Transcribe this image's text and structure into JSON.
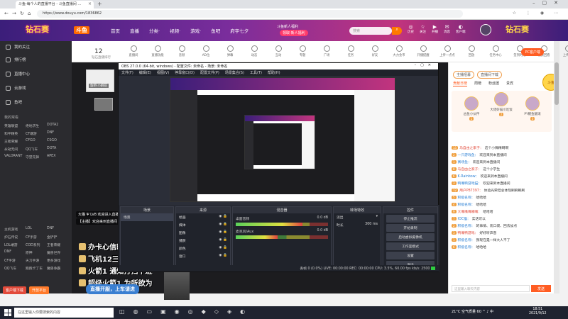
{
  "browser": {
    "tab_title": "斗鱼-每个人的直播平台 - 斗鱼直播间 ...",
    "url": "https://www.douyu.com/1836862",
    "nav": [
      "←",
      "→",
      "↻",
      "⌂"
    ]
  },
  "header": {
    "brand": "钻石赛",
    "logo": "斗鱼",
    "nav": [
      "首页",
      "直播",
      "分类·",
      "视频·",
      "游戏·",
      "鱼吧",
      "府宇七夕"
    ],
    "promo_line": "斗鱼新人福利",
    "promo_btn": "领取·新人福利",
    "search_placeholder": "搜索",
    "user_icons": [
      {
        "icon": "◎",
        "label": "历史"
      },
      {
        "icon": "☆",
        "label": "关注"
      },
      {
        "icon": "▶",
        "label": "开播"
      },
      {
        "icon": "✉",
        "label": "消息"
      },
      {
        "icon": "◐",
        "label": "客户端"
      }
    ],
    "brand2": "钻石赛"
  },
  "sidebar": {
    "items": [
      {
        "label": "我的关注"
      },
      {
        "label": "排行榜"
      },
      {
        "label": "直播中心"
      },
      {
        "label": "云游戏"
      },
      {
        "label": "鱼吧"
      }
    ],
    "category_title": "我的常看",
    "grid": [
      "英雄联盟",
      "绝地求生",
      "DOTA2",
      "和平精英",
      "CF端游",
      "DNF",
      "王者荣耀",
      "CFGO",
      "CSGO",
      "永劫无间",
      "QQ飞车",
      "DOTA",
      "VALORANT",
      "守望先锋",
      "APEX"
    ],
    "grid2": [
      "主机游戏",
      "LOL",
      "DNF",
      "炉石传说",
      "CF手游",
      "金铲铲",
      "LOL端游",
      "COD系列",
      "王者荣耀",
      "DNF",
      "原神",
      "魔兽世界",
      "CF手游",
      "天刀手游",
      "更多游戏",
      "QQ飞车",
      "跑跑卡丁车",
      "魔兽争霸"
    ],
    "btn_red": "客户端下载",
    "btn_orange": "开放平台"
  },
  "room": {
    "count": "12",
    "count_label": "钻石直播排行",
    "pc_btn": "PC客户端",
    "tools": [
      "直播间",
      "直播功能",
      "音频",
      "AD位",
      "弹幕",
      "动态",
      "互动",
      "专题",
      "广场",
      "任务",
      "好友",
      "大力金币",
      "开播提醒",
      "上传一点点",
      "回放",
      "任务中心",
      "签到时段",
      "视频回看",
      "上传UP"
    ]
  },
  "stream": {
    "streamer_caption": "鱼吧·小麻花",
    "chat_lines": [
      "大猫 Ψ LV8 欢迎进入直播间",
      "【主播】欢迎来到直播间"
    ],
    "danmu": [
      "办卡心信时车位",
      "飞机12三小时车位",
      "火箭1 通知打扫下班",
      "超级火箭1 为所欲为"
    ],
    "welcome_tag": "直播开服，上车请进"
  },
  "obs": {
    "title": "OBS 27.0.0 (64-bit, windows) - 配置文件: 未命名 - 场景: 未命名",
    "menu": [
      "文件(F)",
      "编辑(E)",
      "视图(V)",
      "停靠窗口(D)",
      "配置文件(P)",
      "场景集合(S)",
      "工具(T)",
      "帮助(H)"
    ],
    "panels": {
      "scenes_title": "场景",
      "scenes": [
        "场景"
      ],
      "sources_title": "来源",
      "sources": [
        "绘画",
        "媒体",
        "图像",
        "捕获",
        "颜色",
        "窗口"
      ],
      "mixer_title": "混音器",
      "mixer": [
        {
          "name": "桌面音频",
          "db": "0.0 dB",
          "level": 0.72
        },
        {
          "name": "麦克风/Aux",
          "db": "0.0 dB",
          "level": 0.45
        }
      ],
      "transition_title": "转场特效",
      "transition_name": "淡出",
      "duration_label": "时长",
      "duration": "300 ms",
      "controls_title": "控件",
      "controls": [
        "停止推流",
        "开始录制",
        "启动虚拟摄像机",
        "工作室模式",
        "设置",
        "退出"
      ]
    },
    "status": "丢帧 0 (0.0%)   LIVE: 00:00:00   REC: 00:00:00   CPU: 3.5%, 60.00 fps   kb/s: 2500"
  },
  "right": {
    "top_btns": [
      "主播招募",
      "直播间下载"
    ],
    "tabs": [
      "贡献日榜",
      "周榜",
      "粉丝团",
      "贵宾"
    ],
    "rank": [
      {
        "name": "凶鱼小伙伴",
        "lv": "1"
      },
      {
        "name": "大佬好猫爪吃饭",
        "lv": "2"
      },
      {
        "name": "PY鲤鱼翻滚",
        "lv": "3"
      }
    ],
    "chat": [
      {
        "lv": "15",
        "name": "马自由之家子",
        "text": "这个小微精啊啊"
      },
      {
        "lv": "2",
        "name": "一只游戏鱼",
        "text": "欢迎来到本直播间"
      },
      {
        "lv": "1",
        "name": "赛场鱼",
        "text": "欢迎来到本直播间"
      },
      {
        "lv": "8",
        "name": "马自由之家子",
        "text": "这个小学生"
      },
      {
        "lv": "6",
        "name": "K·Rainbow",
        "text": "欢迎来到本直播间"
      },
      {
        "lv": "3",
        "name": "鸭嘴鸭游戏猫",
        "text": "欢迎来到本直播间"
      },
      {
        "lv": "12",
        "name": "用户P87397",
        "text": "体验光荣但总体现刷刷刷刷"
      },
      {
        "lv": "5",
        "name": "积极名称",
        "text": "哈哈哈"
      },
      {
        "lv": "4",
        "name": "积极名称",
        "text": "哈哈哈"
      },
      {
        "lv": "9",
        "name": "大嘴嘴嘴嘴嘴",
        "text": "哈哈哈"
      },
      {
        "lv": "7",
        "name": "IOC猫",
        "text": "实话可以"
      },
      {
        "lv": "2",
        "name": "积极名称",
        "text": "的事情、装口袋、回去加点"
      },
      {
        "lv": "3",
        "name": "鸭嘴鸭游戏",
        "text": "好好听声音"
      },
      {
        "lv": "1",
        "name": "积极名称",
        "text": "我现在是一样大人不了"
      },
      {
        "lv": "6",
        "name": "积极名称",
        "text": "哈哈哈"
      }
    ],
    "input_placeholder": "这里输入聊天内容",
    "send": "发送",
    "mascot": "斗鱼"
  },
  "taskbar": {
    "search": "在这里输入你要搜索的内容",
    "tray": "21°C 空气质量 60  ^  ♪  中",
    "time": "18:51",
    "date": "2021/9/12"
  }
}
